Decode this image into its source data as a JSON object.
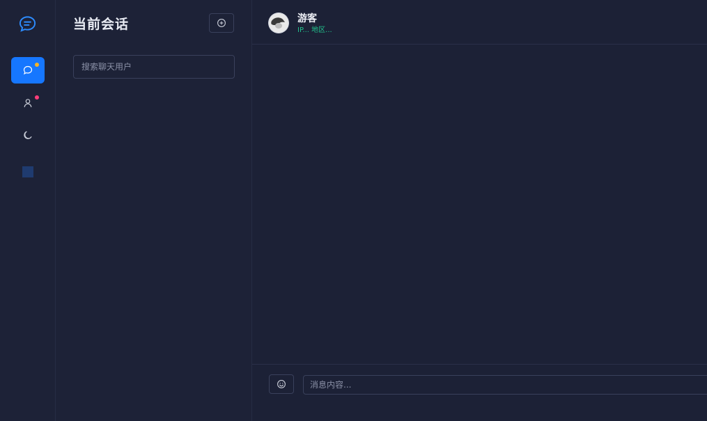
{
  "colors": {
    "background": "#1c2136",
    "panel": "#1d2237",
    "accent": "#1677ff",
    "location_text": "#22c38e",
    "badge_yellow": "#f5b324",
    "badge_pink": "#ff3d7a"
  },
  "rail": {
    "logo_icon": "chat-bubble-icon",
    "items": [
      {
        "icon": "chat-icon",
        "active": true,
        "badge": "yellow"
      },
      {
        "icon": "user-icon",
        "active": false,
        "badge": "pink"
      },
      {
        "icon": "moon-icon",
        "active": false
      },
      {
        "icon": "square-icon",
        "active": false
      }
    ]
  },
  "conversations": {
    "title": "当前会话",
    "add_icon": "plus-circle-icon",
    "search_placeholder": "搜索聊天用户"
  },
  "chat": {
    "user_name": "游客",
    "user_location": "IP... 地区...",
    "emoji_icon": "smile-icon",
    "message_placeholder": "消息内容..."
  }
}
